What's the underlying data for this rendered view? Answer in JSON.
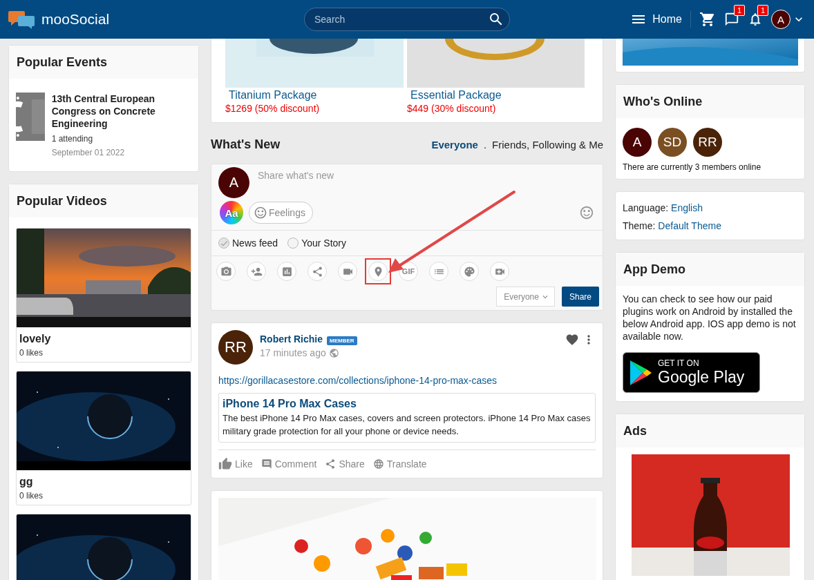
{
  "header": {
    "logo_text": "mooSocial",
    "search": {
      "placeholder": "Search"
    },
    "home": "Home",
    "messages_badge": "1",
    "notifications_badge": "1",
    "avatar": "A"
  },
  "left": {
    "popular_events": {
      "title": "Popular Events",
      "events": [
        {
          "kind": "picture",
          "title": "13th Central European Congress on Concrete Engineering",
          "attending": "1 attending",
          "date": "September 01 2022"
        }
      ]
    },
    "popular_videos": {
      "title": "Popular Videos",
      "videos": [
        {
          "kind": "picture",
          "title": "lovely",
          "likes": "0 likes"
        },
        {
          "kind": "picture",
          "title": "gg",
          "likes": "0 likes"
        },
        {
          "kind": "picture"
        }
      ]
    }
  },
  "center": {
    "packages": [
      {
        "name": "Titanium Package",
        "price": "$1269 (50% discount)"
      },
      {
        "name": "Essential Package",
        "price": "$449 (30% discount)"
      }
    ],
    "whats_new": {
      "title": "What's New",
      "separator": ".",
      "filters": [
        {
          "label": "Everyone",
          "selected": true
        },
        {
          "label": "Friends, Following & Me",
          "selected": false
        }
      ]
    },
    "composer": {
      "avatar": "A",
      "placeholder": "Share what's new",
      "text_style": "Aa",
      "feelings": "Feelings",
      "targets": [
        {
          "label": "News feed",
          "checked": true
        },
        {
          "label": "Your Story",
          "checked": false
        }
      ],
      "tools": [
        {
          "kind": "camera",
          "highlighted": false
        },
        {
          "kind": "tag",
          "highlighted": false
        },
        {
          "kind": "poll",
          "highlighted": false
        },
        {
          "kind": "share",
          "highlighted": false
        },
        {
          "kind": "video",
          "highlighted": false
        },
        {
          "kind": "location",
          "highlighted": true
        },
        {
          "kind": "gif",
          "label": "GIF",
          "highlighted": false
        },
        {
          "kind": "list",
          "highlighted": false
        },
        {
          "kind": "palette",
          "highlighted": false
        },
        {
          "kind": "live",
          "highlighted": false
        }
      ],
      "privacy": "Everyone",
      "submit": "Share"
    },
    "post": {
      "avatar": "RR",
      "author": "Robert Richie",
      "role": "MEMBER",
      "time": "17 minutes ago",
      "link": "https://gorillacasestore.com/collections/iphone-14-pro-max-cases",
      "preview": {
        "title": "iPhone 14 Pro Max Cases",
        "description": "The best iPhone 14 Pro Max cases, covers and screen protectors. iPhone 14 Pro Max cases military grade protection for all your phone or device needs."
      },
      "actions": [
        {
          "kind": "like",
          "label": "Like"
        },
        {
          "kind": "comment",
          "label": "Comment"
        },
        {
          "kind": "share",
          "label": "Share"
        },
        {
          "kind": "translate",
          "label": "Translate"
        }
      ]
    },
    "next_post": {
      "kind": "picture"
    }
  },
  "right": {
    "banner": {
      "kind": "picture"
    },
    "whos_online": {
      "title": "Who's Online",
      "members": [
        {
          "initials": "A",
          "color": "#4a0404"
        },
        {
          "initials": "SD",
          "color": "#7a4f22"
        },
        {
          "initials": "RR",
          "color": "#4a2308"
        }
      ],
      "summary": "There are currently 3 members online"
    },
    "settings": [
      {
        "label": "Language:",
        "value": "English"
      },
      {
        "label": "Theme:",
        "value": "Default Theme"
      }
    ],
    "app_demo": {
      "title": "App Demo",
      "text": "You can check to see how our paid plugins work on Android by installed the below Android app. IOS app demo is not available now.",
      "store_badge": {
        "small": "GET IT ON",
        "large": "Google Play"
      }
    },
    "ads": {
      "title": "Ads",
      "ad": {
        "kind": "picture"
      }
    }
  }
}
